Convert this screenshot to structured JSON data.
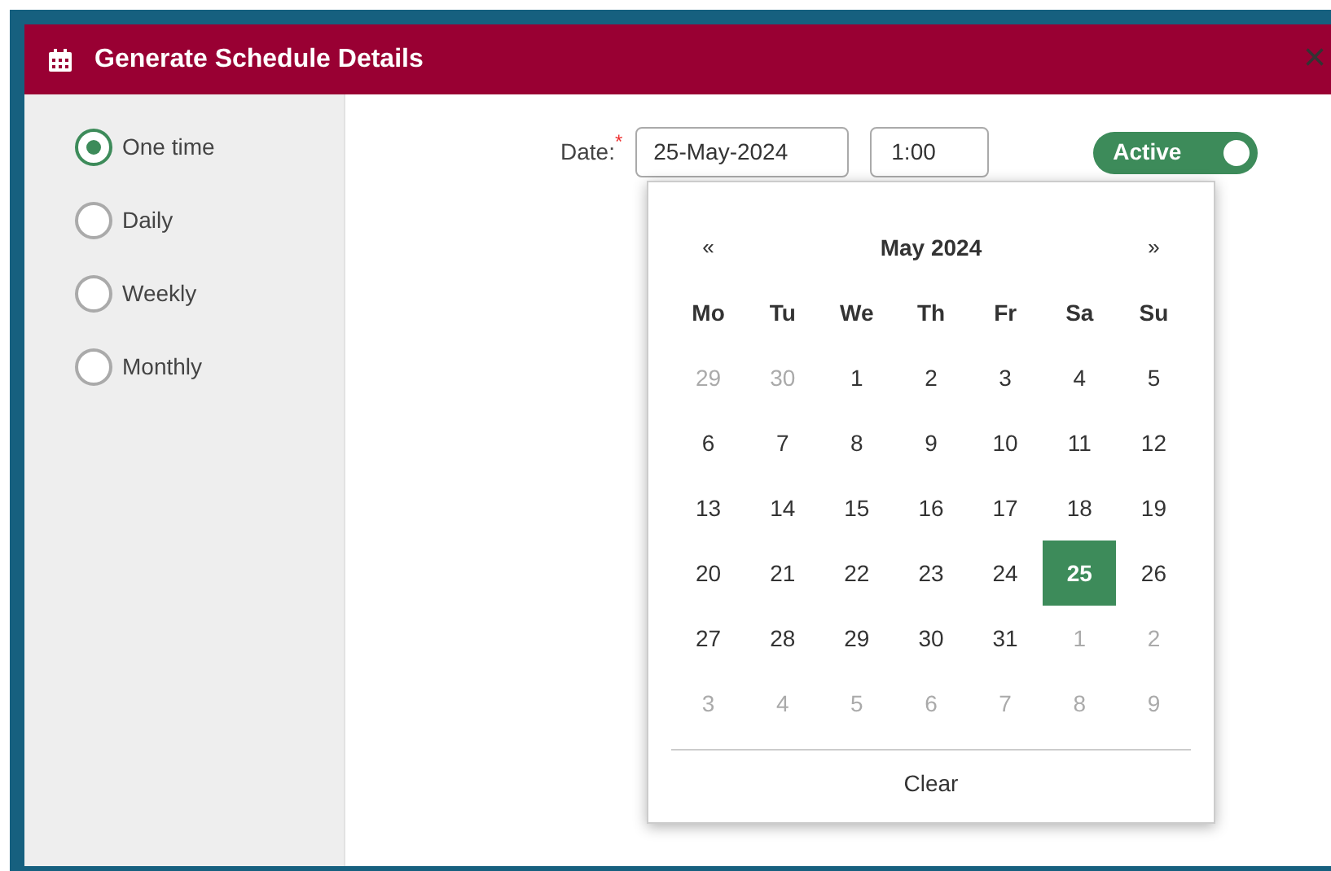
{
  "dialog": {
    "title": "Generate Schedule Details",
    "close": "×"
  },
  "frequency": [
    {
      "label": "One time",
      "selected": true
    },
    {
      "label": "Daily",
      "selected": false
    },
    {
      "label": "Weekly",
      "selected": false
    },
    {
      "label": "Monthly",
      "selected": false
    }
  ],
  "date_label": "Date:",
  "required_mark": "*",
  "date_value": "25-May-2024",
  "time_value": "1:00",
  "active_toggle": {
    "label": "Active",
    "on": true
  },
  "calendar": {
    "prev": "«",
    "month": "May 2024",
    "next": "»",
    "weekdays": [
      "Mo",
      "Tu",
      "We",
      "Th",
      "Fr",
      "Sa",
      "Su"
    ],
    "weeks": [
      [
        {
          "day": "29",
          "muted": true,
          "selected": false
        },
        {
          "day": "30",
          "muted": true,
          "selected": false
        },
        {
          "day": "1",
          "muted": false,
          "selected": false
        },
        {
          "day": "2",
          "muted": false,
          "selected": false
        },
        {
          "day": "3",
          "muted": false,
          "selected": false
        },
        {
          "day": "4",
          "muted": false,
          "selected": false
        },
        {
          "day": "5",
          "muted": false,
          "selected": false
        }
      ],
      [
        {
          "day": "6",
          "muted": false,
          "selected": false
        },
        {
          "day": "7",
          "muted": false,
          "selected": false
        },
        {
          "day": "8",
          "muted": false,
          "selected": false
        },
        {
          "day": "9",
          "muted": false,
          "selected": false
        },
        {
          "day": "10",
          "muted": false,
          "selected": false
        },
        {
          "day": "11",
          "muted": false,
          "selected": false
        },
        {
          "day": "12",
          "muted": false,
          "selected": false
        }
      ],
      [
        {
          "day": "13",
          "muted": false,
          "selected": false
        },
        {
          "day": "14",
          "muted": false,
          "selected": false
        },
        {
          "day": "15",
          "muted": false,
          "selected": false
        },
        {
          "day": "16",
          "muted": false,
          "selected": false
        },
        {
          "day": "17",
          "muted": false,
          "selected": false
        },
        {
          "day": "18",
          "muted": false,
          "selected": false
        },
        {
          "day": "19",
          "muted": false,
          "selected": false
        }
      ],
      [
        {
          "day": "20",
          "muted": false,
          "selected": false
        },
        {
          "day": "21",
          "muted": false,
          "selected": false
        },
        {
          "day": "22",
          "muted": false,
          "selected": false
        },
        {
          "day": "23",
          "muted": false,
          "selected": false
        },
        {
          "day": "24",
          "muted": false,
          "selected": false
        },
        {
          "day": "25",
          "muted": false,
          "selected": true
        },
        {
          "day": "26",
          "muted": false,
          "selected": false
        }
      ],
      [
        {
          "day": "27",
          "muted": false,
          "selected": false
        },
        {
          "day": "28",
          "muted": false,
          "selected": false
        },
        {
          "day": "29",
          "muted": false,
          "selected": false
        },
        {
          "day": "30",
          "muted": false,
          "selected": false
        },
        {
          "day": "31",
          "muted": false,
          "selected": false
        },
        {
          "day": "1",
          "muted": true,
          "selected": false
        },
        {
          "day": "2",
          "muted": true,
          "selected": false
        }
      ],
      [
        {
          "day": "3",
          "muted": true,
          "selected": false
        },
        {
          "day": "4",
          "muted": true,
          "selected": false
        },
        {
          "day": "5",
          "muted": true,
          "selected": false
        },
        {
          "day": "6",
          "muted": true,
          "selected": false
        },
        {
          "day": "7",
          "muted": true,
          "selected": false
        },
        {
          "day": "8",
          "muted": true,
          "selected": false
        },
        {
          "day": "9",
          "muted": true,
          "selected": false
        }
      ]
    ],
    "clear": "Clear"
  }
}
